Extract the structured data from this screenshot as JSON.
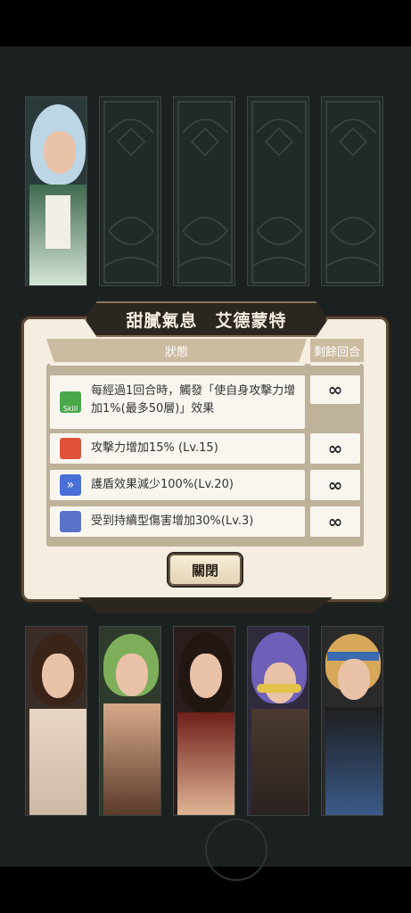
{
  "dialog": {
    "title_left": "甜膩氣息",
    "title_right": "艾德蒙特",
    "header_status": "狀態",
    "header_turns": "剩餘回合",
    "effects": [
      {
        "icon": "skill-icon",
        "icon_label": "Skill",
        "icon_color": "#4aa84a",
        "line1": "每經過1回合時，觸發「使自身攻擊力增",
        "line2": "加1%(最多50層)」效果",
        "turns": "∞"
      },
      {
        "icon": "attack-up-icon",
        "icon_color": "#e0523a",
        "line1": "攻擊力增加15% (Lv.15)",
        "turns": "∞"
      },
      {
        "icon": "shield-down-icon",
        "icon_color": "#4a6fd8",
        "line1": "護盾效果減少100%(Lv.20)",
        "turns": "∞"
      },
      {
        "icon": "dot-damage-up-icon",
        "icon_color": "#5a72c8",
        "line1": "受到持續型傷害增加30%(Lv.3)",
        "turns": "∞"
      }
    ],
    "close_label": "關閉"
  },
  "colors": {
    "background": "#1b2120",
    "dialog_bg": "#f4ede0",
    "banner": "#2b2620",
    "header": "#cbbba0"
  }
}
